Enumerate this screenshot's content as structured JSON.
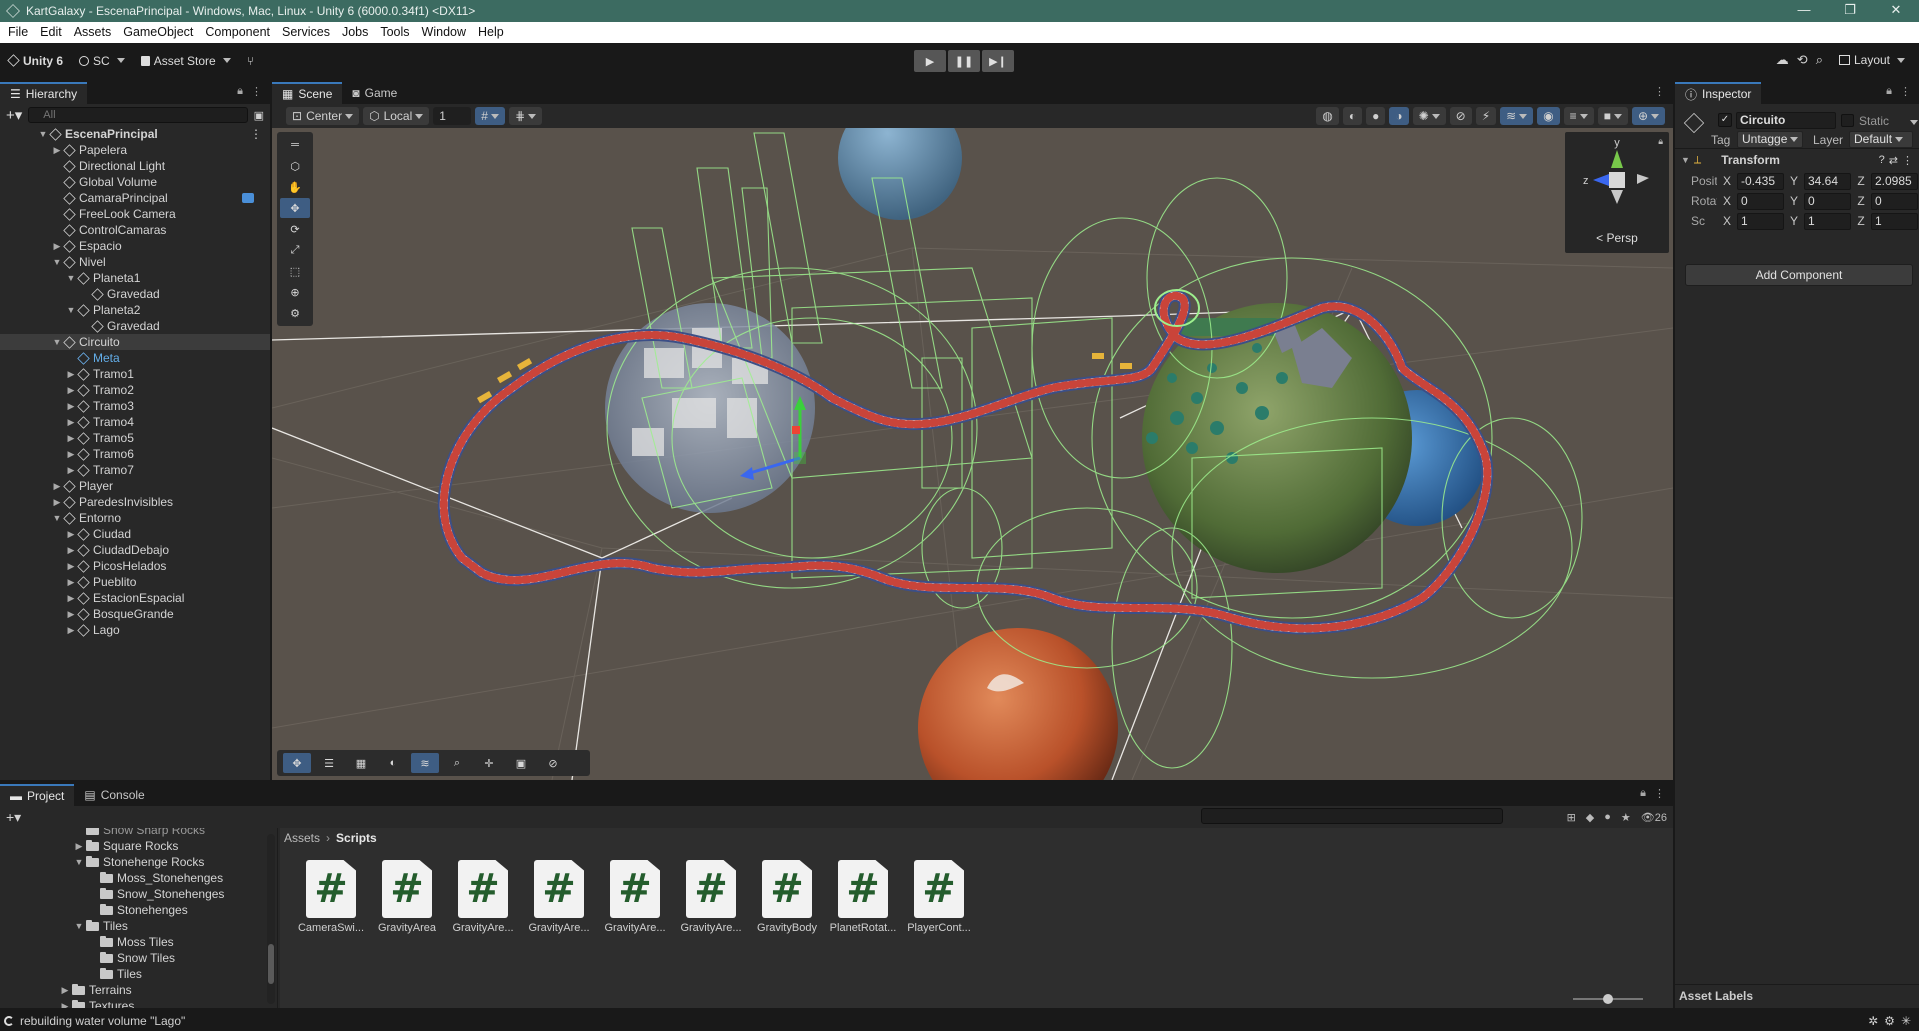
{
  "window": {
    "title": "KartGalaxy - EscenaPrincipal - Windows, Mac, Linux - Unity 6 (6000.0.34f1) <DX11>",
    "controls": [
      "—",
      "❐",
      "✕"
    ]
  },
  "menu": [
    "File",
    "Edit",
    "Assets",
    "GameObject",
    "Component",
    "Services",
    "Jobs",
    "Tools",
    "Window",
    "Help"
  ],
  "toolbar": {
    "unity_label": "Unity 6",
    "account_label": "SC",
    "asset_store_label": "Asset Store",
    "layout_label": "Layout"
  },
  "hierarchy": {
    "tab_label": "Hierarchy",
    "search_placeholder": "All",
    "rows": [
      {
        "label": "EscenaPrincipal",
        "indent": 0,
        "arrow": "▼",
        "kind": "scene"
      },
      {
        "label": "Papelera",
        "indent": 1,
        "arrow": "▶"
      },
      {
        "label": "Directional Light",
        "indent": 1,
        "arrow": ""
      },
      {
        "label": "Global Volume",
        "indent": 1,
        "arrow": ""
      },
      {
        "label": "CamaraPrincipal",
        "indent": 1,
        "arrow": "",
        "badge": true
      },
      {
        "label": "FreeLook Camera",
        "indent": 1,
        "arrow": ""
      },
      {
        "label": "ControlCamaras",
        "indent": 1,
        "arrow": ""
      },
      {
        "label": "Espacio",
        "indent": 1,
        "arrow": "▶"
      },
      {
        "label": "Nivel",
        "indent": 1,
        "arrow": "▼"
      },
      {
        "label": "Planeta1",
        "indent": 2,
        "arrow": "▼"
      },
      {
        "label": "Gravedad",
        "indent": 3,
        "arrow": ""
      },
      {
        "label": "Planeta2",
        "indent": 2,
        "arrow": "▼"
      },
      {
        "label": "Gravedad",
        "indent": 3,
        "arrow": ""
      },
      {
        "label": "Circuito",
        "indent": 1,
        "arrow": "▼",
        "kind": "selected"
      },
      {
        "label": "Meta",
        "indent": 2,
        "arrow": "",
        "kind": "meta"
      },
      {
        "label": "Tramo1",
        "indent": 2,
        "arrow": "▶"
      },
      {
        "label": "Tramo2",
        "indent": 2,
        "arrow": "▶"
      },
      {
        "label": "Tramo3",
        "indent": 2,
        "arrow": "▶"
      },
      {
        "label": "Tramo4",
        "indent": 2,
        "arrow": "▶"
      },
      {
        "label": "Tramo5",
        "indent": 2,
        "arrow": "▶"
      },
      {
        "label": "Tramo6",
        "indent": 2,
        "arrow": "▶"
      },
      {
        "label": "Tramo7",
        "indent": 2,
        "arrow": "▶"
      },
      {
        "label": "Player",
        "indent": 1,
        "arrow": "▶"
      },
      {
        "label": "ParedesInvisibles",
        "indent": 1,
        "arrow": "▶"
      },
      {
        "label": "Entorno",
        "indent": 1,
        "arrow": "▼"
      },
      {
        "label": "Ciudad",
        "indent": 2,
        "arrow": "▶"
      },
      {
        "label": "CiudadDebajo",
        "indent": 2,
        "arrow": "▶"
      },
      {
        "label": "PicosHelados",
        "indent": 2,
        "arrow": "▶"
      },
      {
        "label": "Pueblito",
        "indent": 2,
        "arrow": "▶"
      },
      {
        "label": "EstacionEspacial",
        "indent": 2,
        "arrow": "▶"
      },
      {
        "label": "BosqueGrande",
        "indent": 2,
        "arrow": "▶"
      },
      {
        "label": "Lago",
        "indent": 2,
        "arrow": "▶"
      }
    ]
  },
  "scene": {
    "tabs": [
      "Scene",
      "Game"
    ],
    "pivot_label": "Center",
    "space_label": "Local",
    "grid_value": "1",
    "persp_label": "Persp",
    "gizmo_axes": {
      "y": "y",
      "z": "z"
    }
  },
  "inspector": {
    "tab_label": "Inspector",
    "object_name": "Circuito",
    "static_label": "Static",
    "tag_label": "Tag",
    "tag_value": "Untagge",
    "layer_label": "Layer",
    "layer_value": "Default",
    "component_title": "Transform",
    "rows": [
      {
        "label": "Positic",
        "x": "-0.435",
        "y": "34.64",
        "z": "2.0985"
      },
      {
        "label": "Rotatic",
        "x": "0",
        "y": "0",
        "z": "0"
      },
      {
        "label": "Sc",
        "x": "1",
        "y": "1",
        "z": "1"
      }
    ],
    "axis_labels": {
      "x": "X",
      "y": "Y",
      "z": "Z"
    },
    "add_component_label": "Add Component",
    "asset_labels": "Asset Labels"
  },
  "project": {
    "tabs": [
      "Project",
      "Console"
    ],
    "count_label": "26",
    "tree": [
      {
        "label": "Snow Sharp Rocks",
        "indent": 2,
        "arrow": ""
      },
      {
        "label": "Square Rocks",
        "indent": 2,
        "arrow": "▶"
      },
      {
        "label": "Stonehenge Rocks",
        "indent": 2,
        "arrow": "▼"
      },
      {
        "label": "Moss_Stonehenges",
        "indent": 3,
        "arrow": ""
      },
      {
        "label": "Snow_Stonehenges",
        "indent": 3,
        "arrow": ""
      },
      {
        "label": "Stonehenges",
        "indent": 3,
        "arrow": ""
      },
      {
        "label": "Tiles",
        "indent": 2,
        "arrow": "▼"
      },
      {
        "label": "Moss Tiles",
        "indent": 3,
        "arrow": ""
      },
      {
        "label": "Snow Tiles",
        "indent": 3,
        "arrow": ""
      },
      {
        "label": "Tiles",
        "indent": 3,
        "arrow": ""
      },
      {
        "label": "Terrains",
        "indent": 1,
        "arrow": "▶"
      },
      {
        "label": "Textures",
        "indent": 1,
        "arrow": "▶"
      }
    ],
    "breadcrumb": [
      "Assets",
      "Scripts"
    ],
    "scripts": [
      "CameraSwi...",
      "GravityArea",
      "GravityAre...",
      "GravityAre...",
      "GravityAre...",
      "GravityAre...",
      "GravityBody",
      "PlanetRotat...",
      "PlayerCont..."
    ]
  },
  "status": {
    "message": "rebuilding water volume \"Lago\""
  }
}
